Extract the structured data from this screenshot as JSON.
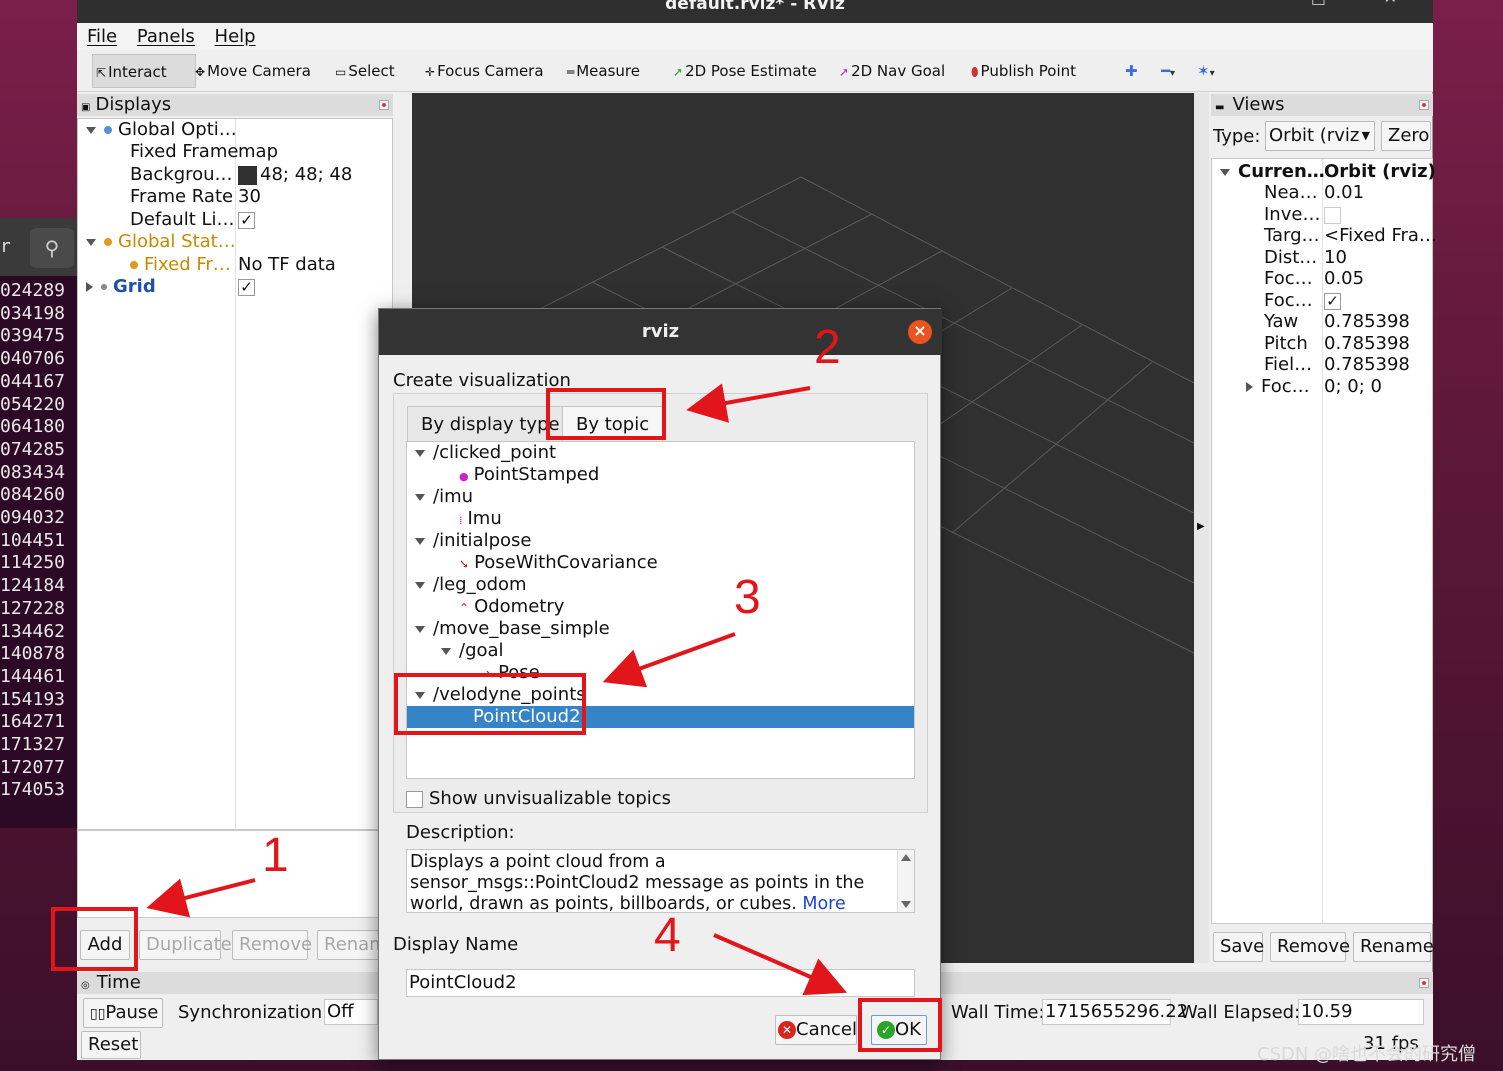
{
  "window": {
    "title": "default.rviz* - RViz",
    "menu": [
      "File",
      "Panels",
      "Help"
    ]
  },
  "terminal": {
    "prompt_fragment": "r",
    "lines": [
      "024289",
      "034198",
      "039475",
      "040706",
      "044167",
      "054220",
      "064180",
      "074285",
      "083434",
      "084260",
      "094032",
      "104451",
      "114250",
      "124184",
      "127228",
      "134462",
      "140878",
      "144461",
      "154193",
      "164271",
      "171327",
      "172077",
      "174053"
    ]
  },
  "toolbar": {
    "items": [
      "Interact",
      "Move Camera",
      "Select",
      "Focus Camera",
      "Measure",
      "2D Pose Estimate",
      "2D Nav Goal",
      "Publish Point"
    ]
  },
  "displays": {
    "title": "Displays",
    "rows": {
      "global_options": "Global Opti…",
      "fixed_frame_label": "Fixed Frame",
      "fixed_frame_value": "map",
      "background_label": "Backgrou…",
      "background_value": "48; 48; 48",
      "frame_rate_label": "Frame Rate",
      "frame_rate_value": "30",
      "default_light_label": "Default Li…",
      "global_status": "Global Stat…",
      "fixed_frame_status": "Fixed Fr…",
      "fixed_frame_status_value": "No TF data",
      "grid": "Grid"
    },
    "buttons": {
      "add": "Add",
      "duplicate": "Duplicate",
      "remove": "Remove",
      "rename": "Renam"
    }
  },
  "views": {
    "title": "Views",
    "type_label": "Type:",
    "type_value": "Orbit (rviz",
    "zero": "Zero",
    "rows": [
      {
        "k": "Curren…",
        "v": "Orbit (rviz)"
      },
      {
        "k": "Nea…",
        "v": "0.01"
      },
      {
        "k": "Inve…",
        "v": ""
      },
      {
        "k": "Targ…",
        "v": "<Fixed Fra…"
      },
      {
        "k": "Dist…",
        "v": "10"
      },
      {
        "k": "Foc…",
        "v": "0.05"
      },
      {
        "k": "Foc…",
        "v": ""
      },
      {
        "k": "Yaw",
        "v": "0.785398"
      },
      {
        "k": "Pitch",
        "v": "0.785398"
      },
      {
        "k": "Fiel…",
        "v": "0.785398"
      },
      {
        "k": "Foc…",
        "v": "0; 0; 0"
      }
    ],
    "buttons": {
      "save": "Save",
      "remove": "Remove",
      "rename": "Rename"
    }
  },
  "time": {
    "title": "Time",
    "pause": "Pause",
    "sync_label": "Synchronization:",
    "sync_value": "Off",
    "wall_time_label": "Wall Time:",
    "wall_time_value": "1715655296.22",
    "wall_elapsed_label": "Wall Elapsed:",
    "wall_elapsed_value": "10.59",
    "reset": "Reset",
    "fps": "31 fps"
  },
  "dialog": {
    "title": "rviz",
    "close": "×",
    "heading": "Create visualization",
    "tabs": [
      "By display type",
      "By topic"
    ],
    "topics": [
      "/clicked_point",
      "PointStamped",
      "/imu",
      "Imu",
      "/initialpose",
      "PoseWithCovariance",
      "/leg_odom",
      "Odometry",
      "/move_base_simple",
      "/goal",
      "Pose",
      "/velodyne_points",
      "PointCloud2"
    ],
    "show_unvisualizable": "Show unvisualizable topics",
    "description_label": "Description:",
    "description": "Displays a point cloud from a sensor_msgs::PointCloud2 message as points in the world, drawn as points, billboards, or cubes. ",
    "more_info": "More Information",
    "description_end": ".",
    "display_name_label": "Display Name",
    "display_name_value": "PointCloud2",
    "cancel": "Cancel",
    "ok": "OK"
  },
  "annotations": {
    "n1": "1",
    "n2": "2",
    "n3": "3",
    "n4": "4"
  },
  "watermark": "CSDN @啥也不会的研究僧",
  "colors": {
    "highlight": "#3584c7",
    "annotation_red": "#e2151b",
    "viewport": "#303030",
    "close_orange": "#e95420"
  }
}
